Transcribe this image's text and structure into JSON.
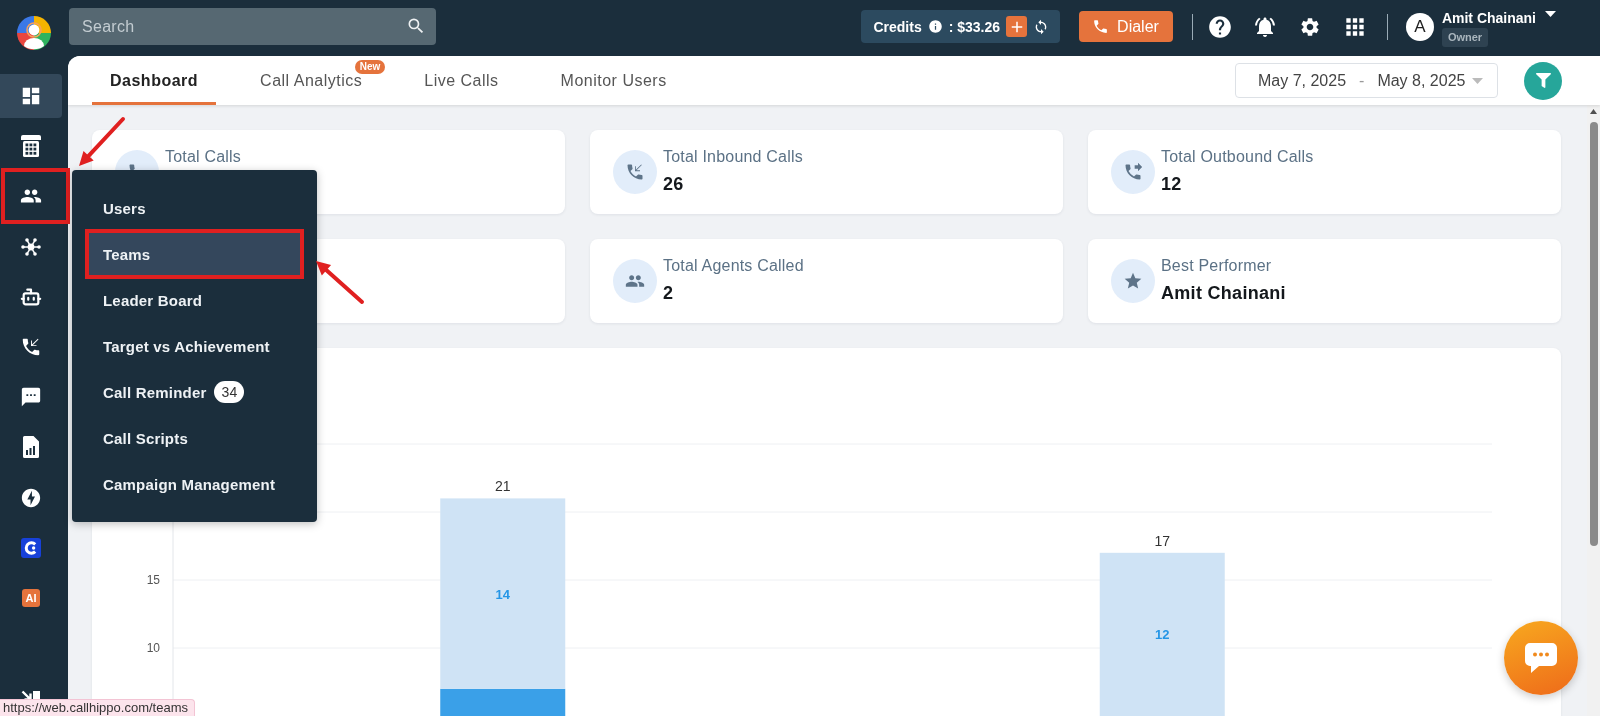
{
  "top_bar": {
    "search": {
      "placeholder": "Search"
    },
    "credits": {
      "label": "Credits",
      "amount": ": $33.26"
    },
    "dialer": {
      "label": "Dialer"
    },
    "user": {
      "initial": "A",
      "name": "Amit Chainani",
      "role": "Owner"
    }
  },
  "sidebar": {
    "items": [
      {
        "selected": true,
        "annotated": false
      },
      {
        "selected": false,
        "annotated": false
      },
      {
        "selected": false,
        "annotated": true
      },
      {
        "selected": false,
        "annotated": false
      },
      {
        "selected": false,
        "annotated": false
      },
      {
        "selected": false,
        "annotated": false
      },
      {
        "selected": false,
        "annotated": false
      },
      {
        "selected": false,
        "annotated": false
      },
      {
        "selected": false,
        "annotated": false
      },
      {
        "selected": false,
        "annotated": false
      },
      {
        "label": "AI",
        "selected": false,
        "annotated": false
      },
      {
        "selected": false,
        "annotated": false
      }
    ]
  },
  "tabs": [
    {
      "label": "Dashboard",
      "selected": true
    },
    {
      "label": "Call Analytics",
      "selected": false,
      "badge": "New"
    },
    {
      "label": "Live Calls",
      "selected": false
    },
    {
      "label": "Monitor Users",
      "selected": false
    }
  ],
  "date_range": {
    "start": "May 7, 2025",
    "separator": "-",
    "end": "May 8, 2025"
  },
  "stats": [
    {
      "kind": "stat",
      "label": "Total Calls"
    },
    {
      "kind": "stat",
      "label": "Total Inbound Calls",
      "value": "26"
    },
    {
      "kind": "stat",
      "label": "Total Outbound Calls",
      "value": "12"
    },
    {
      "kind": "blank"
    },
    {
      "kind": "stat",
      "label": "Total Agents Called",
      "value": "2"
    },
    {
      "kind": "stat",
      "label": "Best Performer",
      "value": "Amit Chainani"
    }
  ],
  "flyout_menu": {
    "items": [
      {
        "label": "Users",
        "selected": false,
        "annotated": false
      },
      {
        "label": "Teams",
        "selected": true,
        "annotated": true
      },
      {
        "label": "Leader Board",
        "selected": false,
        "annotated": false
      },
      {
        "label": "Target vs Achievement",
        "selected": false,
        "annotated": false
      },
      {
        "label": "Call Reminder",
        "badge": "34",
        "selected": false,
        "annotated": false
      },
      {
        "label": "Call Scripts",
        "selected": false,
        "annotated": false
      },
      {
        "label": "Campaign Management",
        "selected": false,
        "annotated": false
      }
    ]
  },
  "chart": {
    "chart_data": {
      "type": "bar",
      "stacked": true,
      "ylim": [
        5,
        25
      ],
      "yticks": [
        10,
        15
      ],
      "series": [
        {
          "color": "#3aa0e8",
          "values": [
            7,
            5
          ]
        },
        {
          "color": "#cfe3f5",
          "values": [
            14,
            12
          ]
        }
      ],
      "value_labels": [
        [
          null,
          null
        ],
        [
          "14",
          "12"
        ]
      ],
      "annotations": [
        {
          "y": 21,
          "text": "21"
        },
        {
          "y": 17,
          "text": "17"
        }
      ]
    }
  },
  "status_url": "https://web.callhippo.com/teams"
}
